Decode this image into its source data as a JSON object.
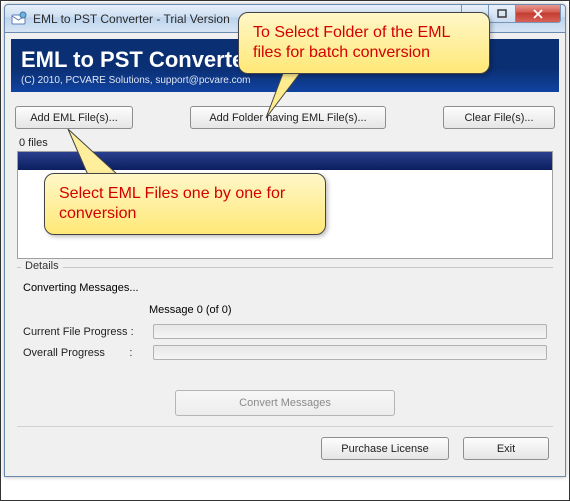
{
  "window": {
    "title": "EML to PST Converter - Trial Version"
  },
  "banner": {
    "heading": "EML to PST Converter",
    "sub": "(C) 2010, PCVARE Solutions, support@pcvare.com"
  },
  "buttons": {
    "add_files": "Add EML File(s)...",
    "add_folder": "Add Folder having EML File(s)...",
    "clear": "Clear File(s)...",
    "convert": "Convert Messages",
    "purchase": "Purchase License",
    "exit": "Exit"
  },
  "list": {
    "count": "0 files"
  },
  "details": {
    "group": "Details",
    "status": "Converting Messages...",
    "message_count": "Message 0 (of 0)",
    "current_label": "Current File Progress :",
    "overall_label": "Overall Progress",
    "colon": ":"
  },
  "callouts": {
    "top": "To Select Folder of the EML files for batch conversion",
    "mid": "Select EML Files one by one for conversion"
  }
}
